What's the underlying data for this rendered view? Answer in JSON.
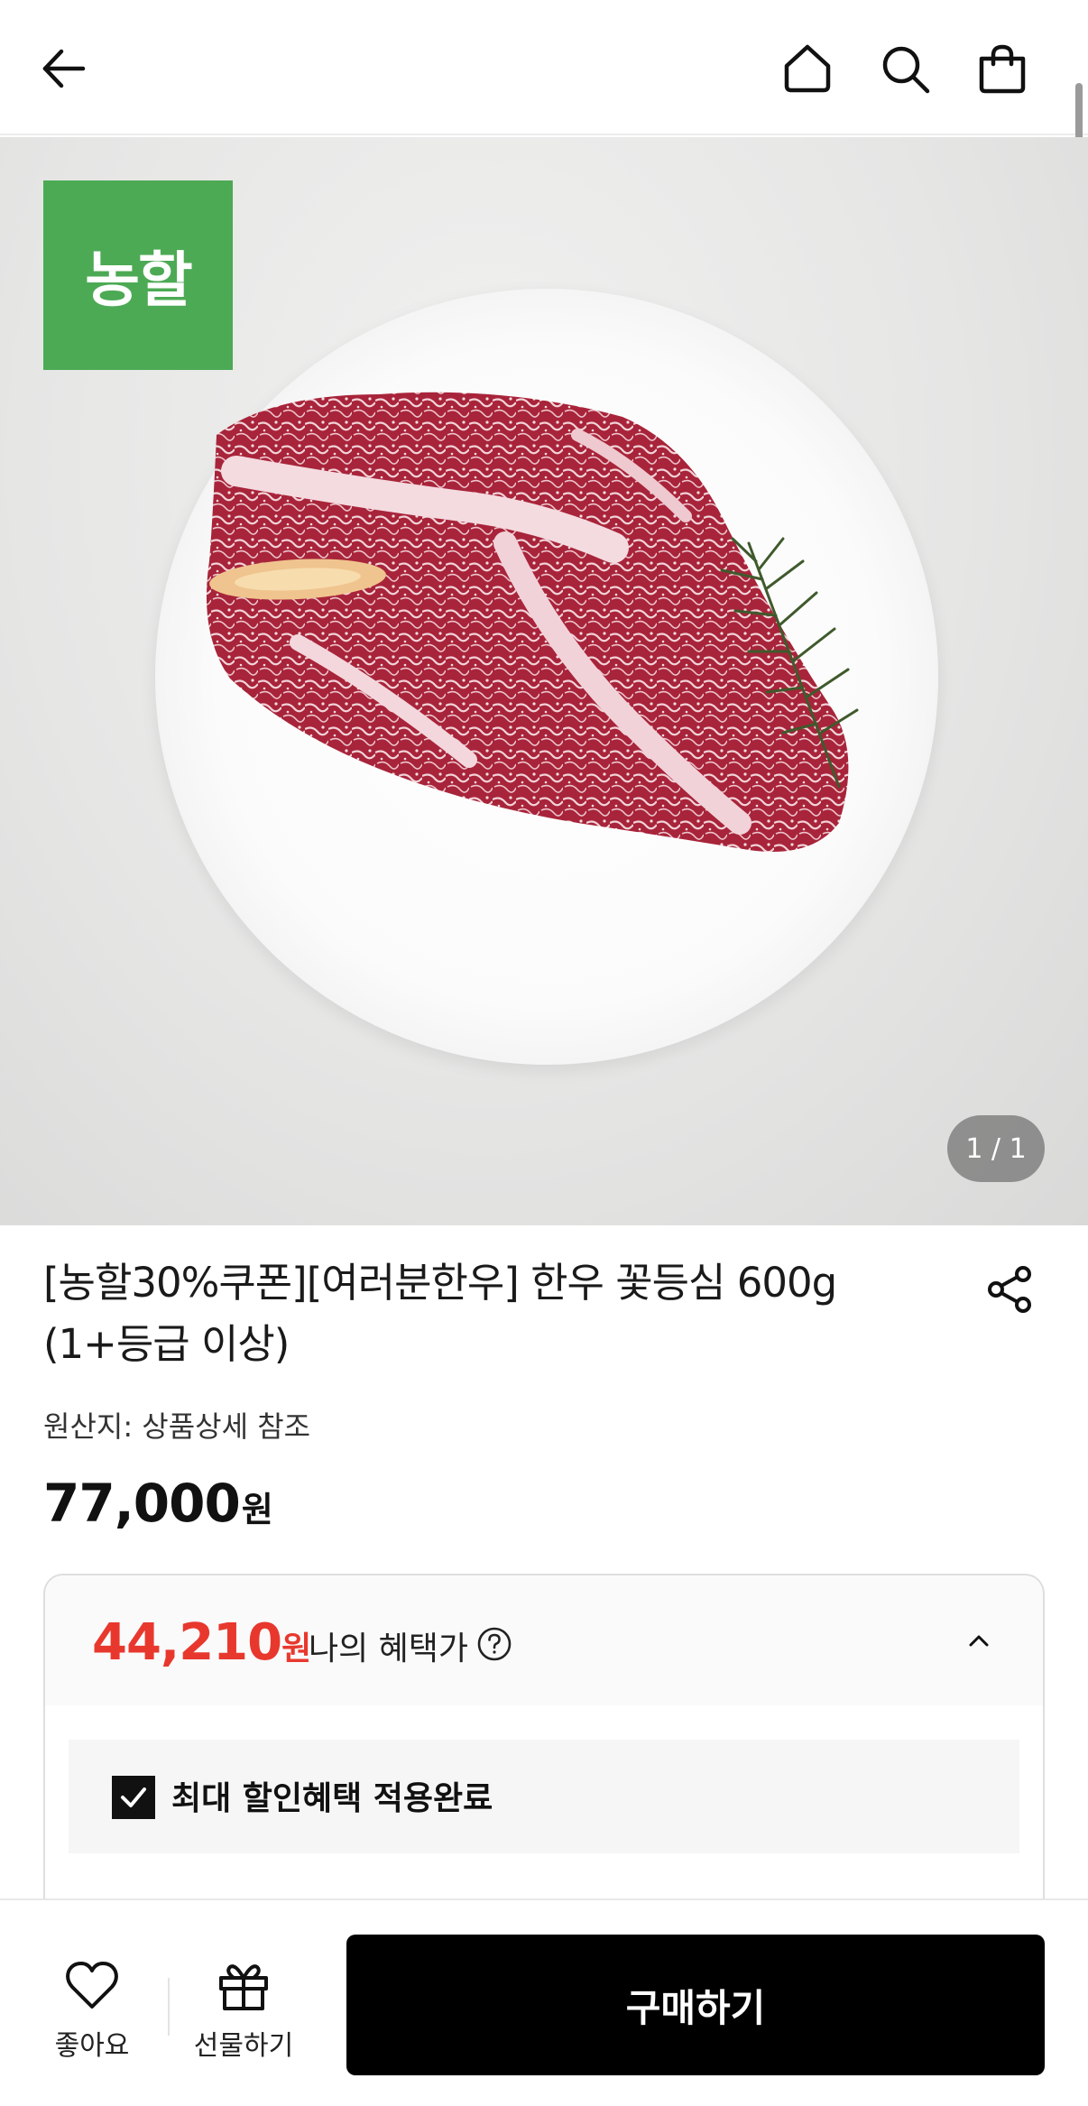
{
  "header": {
    "back_icon": "arrow-left-icon",
    "home_icon": "home-icon",
    "search_icon": "search-icon",
    "cart_icon": "shopping-bag-icon"
  },
  "hero": {
    "brand_badge": "농할",
    "brand_color": "#4caa54",
    "page_indicator": "1 / 1"
  },
  "product": {
    "title_line1": "[농할30%쿠폰][여러분한우] 한우 꽃등심 600g",
    "title_line2": "(1+등급 이상)",
    "origin": "원산지: 상품상세 참조",
    "price": "77,000",
    "price_unit": "원",
    "share_icon": "share-icon"
  },
  "benefit": {
    "price": "44,210",
    "price_unit": "원",
    "label": "나의 혜택가",
    "price_color": "#e8382e",
    "applied_label": "최대 할인혜택 적용완료"
  },
  "bottom_bar": {
    "like_label": "좋아요",
    "gift_label": "선물하기",
    "buy_label": "구매하기"
  }
}
